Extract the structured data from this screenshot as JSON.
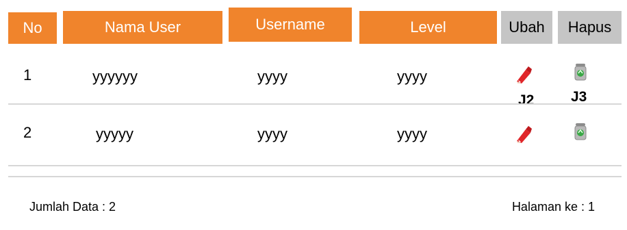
{
  "table": {
    "headers": {
      "no": "No",
      "nama_user": "Nama User",
      "username": "Username",
      "level": "Level",
      "ubah": "Ubah",
      "hapus": "Hapus"
    },
    "rows": [
      {
        "no": "1",
        "nama_user": "yyyyyy",
        "username": "yyyy",
        "level": "yyyy"
      },
      {
        "no": "2",
        "nama_user": "yyyyy",
        "username": "yyyy",
        "level": "yyyy"
      }
    ],
    "labels": {
      "edit": "J2",
      "delete": "J3"
    }
  },
  "footer": {
    "total": "Jumlah Data : 2",
    "page": "Halaman ke : 1"
  },
  "colors": {
    "header_orange": "#f0842c",
    "header_gray": "#c5c5c5",
    "rule": "#d7d7d7"
  },
  "icons": {
    "edit": "pencil-eraser-icon",
    "delete": "recycle-bin-icon"
  }
}
